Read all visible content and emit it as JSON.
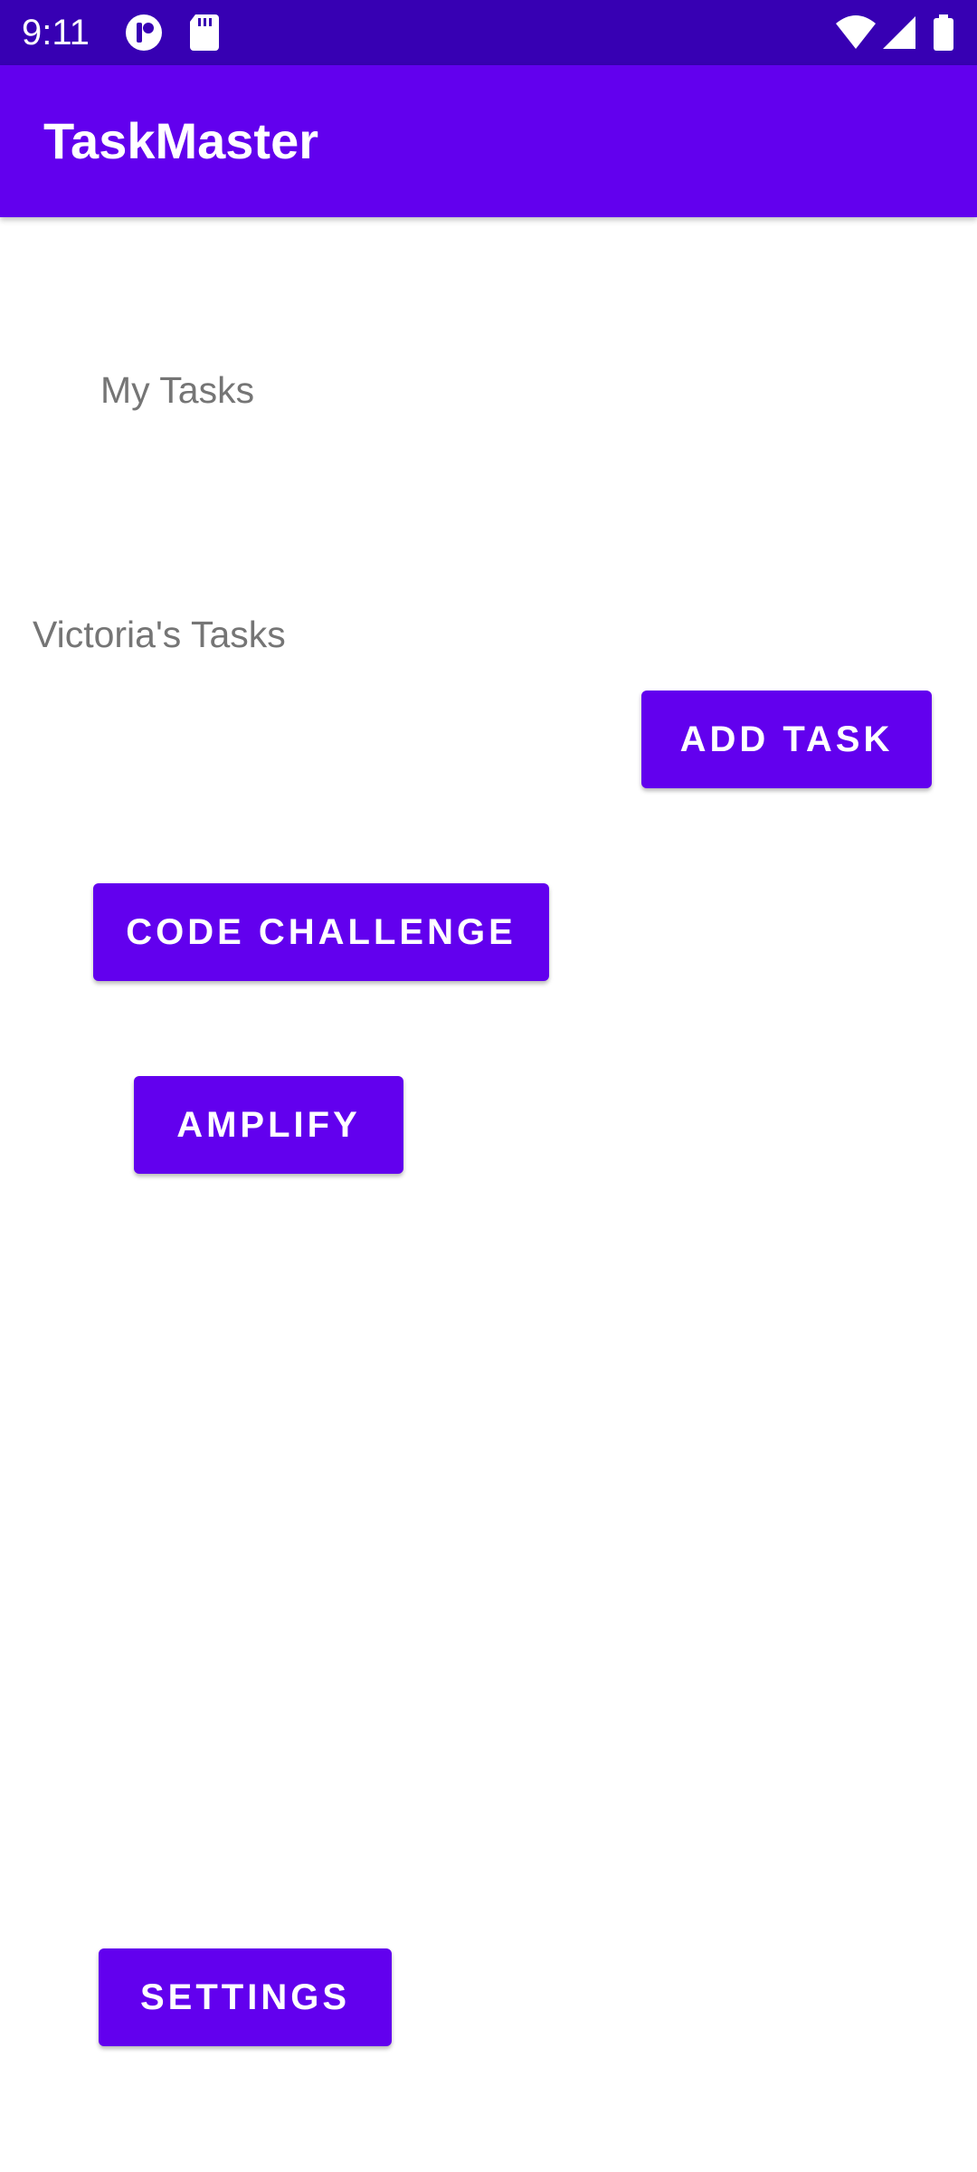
{
  "status_bar": {
    "time": "9:11",
    "icons": [
      "notification-app-icon",
      "sd-card-icon",
      "wifi-icon",
      "cellular-signal-icon",
      "battery-icon"
    ]
  },
  "app_bar": {
    "title": "TaskMaster"
  },
  "main": {
    "my_tasks_label": "My Tasks",
    "user_tasks_label": "Victoria's Tasks",
    "buttons": {
      "add_task": "ADD TASK",
      "code_challenge": "CODE CHALLENGE",
      "amplify": "AMPLIFY",
      "settings": "SETTINGS"
    }
  },
  "colors": {
    "status_bar": "#3700b3",
    "primary": "#6200ee",
    "label_text": "#757575",
    "background": "#ffffff"
  }
}
